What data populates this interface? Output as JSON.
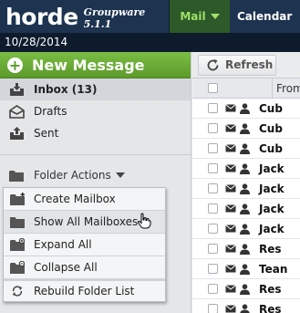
{
  "header": {
    "logo": "horde",
    "product": "Groupware 5.1.1",
    "tabs": [
      {
        "label": "Mail"
      },
      {
        "label": "Calendar"
      }
    ]
  },
  "date": "10/28/2014",
  "sidebar": {
    "new_message": "New Message",
    "folders": [
      {
        "label": "Inbox (13)"
      },
      {
        "label": "Drafts"
      },
      {
        "label": "Sent"
      }
    ],
    "folder_actions": "Folder Actions"
  },
  "menu": {
    "items": [
      {
        "label": "Create Mailbox"
      },
      {
        "label": "Show All Mailboxes"
      },
      {
        "label": "Expand All"
      },
      {
        "label": "Collapse All"
      },
      {
        "label": "Rebuild Folder List"
      }
    ]
  },
  "main": {
    "refresh": "Refresh",
    "column_from": "From",
    "senders": [
      "Cub",
      "Cub",
      "Cub",
      "Jack",
      "Jack",
      "Jack",
      "Jack",
      "Res",
      "Tean",
      "Res",
      "Res"
    ]
  },
  "colors": {
    "topbar": "#1d3350",
    "mail_tab": "#2d5a28",
    "mail_tab_text": "#9fe06a",
    "new_message": "#6aab37"
  }
}
